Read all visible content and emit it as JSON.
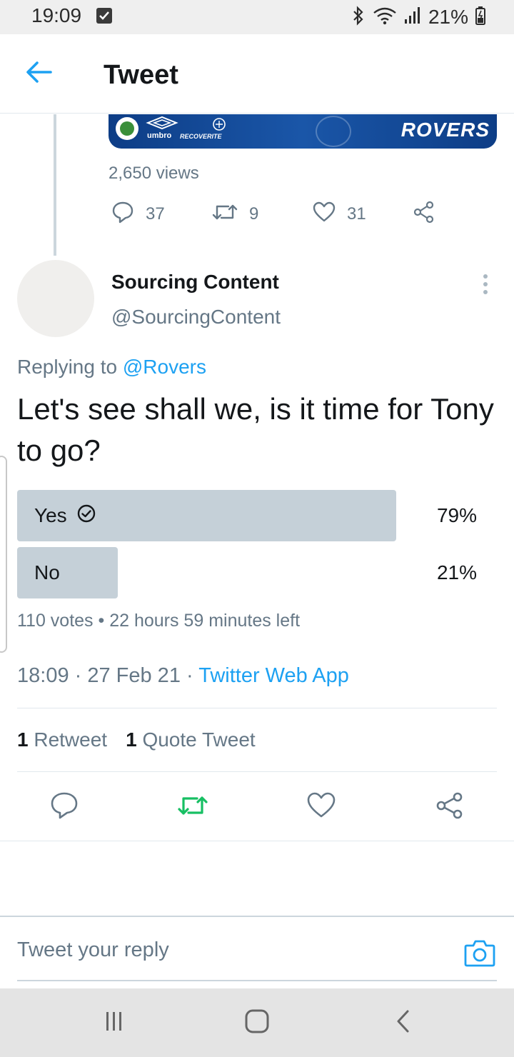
{
  "status_bar": {
    "time": "19:09",
    "battery": "21%",
    "icons": [
      "check-icon",
      "bluetooth-icon",
      "wifi-icon",
      "signal-icon",
      "battery-icon"
    ]
  },
  "header": {
    "title": "Tweet",
    "back_icon": "arrow-left-icon"
  },
  "previous_tweet": {
    "banner_text": "ROVERS",
    "banner_umbro": "umbro",
    "banner_recoverite": "RECOVERITE",
    "views": "2,650 views",
    "reply_count": "37",
    "retweet_count": "9",
    "like_count": "31"
  },
  "tweet": {
    "author_name": "Sourcing Content",
    "author_handle": "@SourcingContent",
    "replying_prefix": "Replying to",
    "replying_handle": "@Rovers",
    "text": "Let's see shall we, is it time for Tony to go?",
    "poll": {
      "options": [
        {
          "label": "Yes",
          "percent_text": "79%",
          "percent": 79,
          "selected": true
        },
        {
          "label": "No",
          "percent_text": "21%",
          "percent": 21,
          "selected": false
        }
      ],
      "meta": "110 votes • 22 hours 59 minutes left"
    },
    "timestamp": "18:09 · 27 Feb 21 · ",
    "source_app": "Twitter Web App",
    "retweets_num": "1",
    "retweets_label": "Retweet",
    "quotes_num": "1",
    "quotes_label": "Quote Tweet"
  },
  "reply": {
    "placeholder": "Tweet your reply"
  },
  "colors": {
    "accent": "#1da1f2",
    "retweet_active": "#17bf63",
    "secondary_text": "#657786",
    "poll_bar": "#c5d0d8"
  }
}
